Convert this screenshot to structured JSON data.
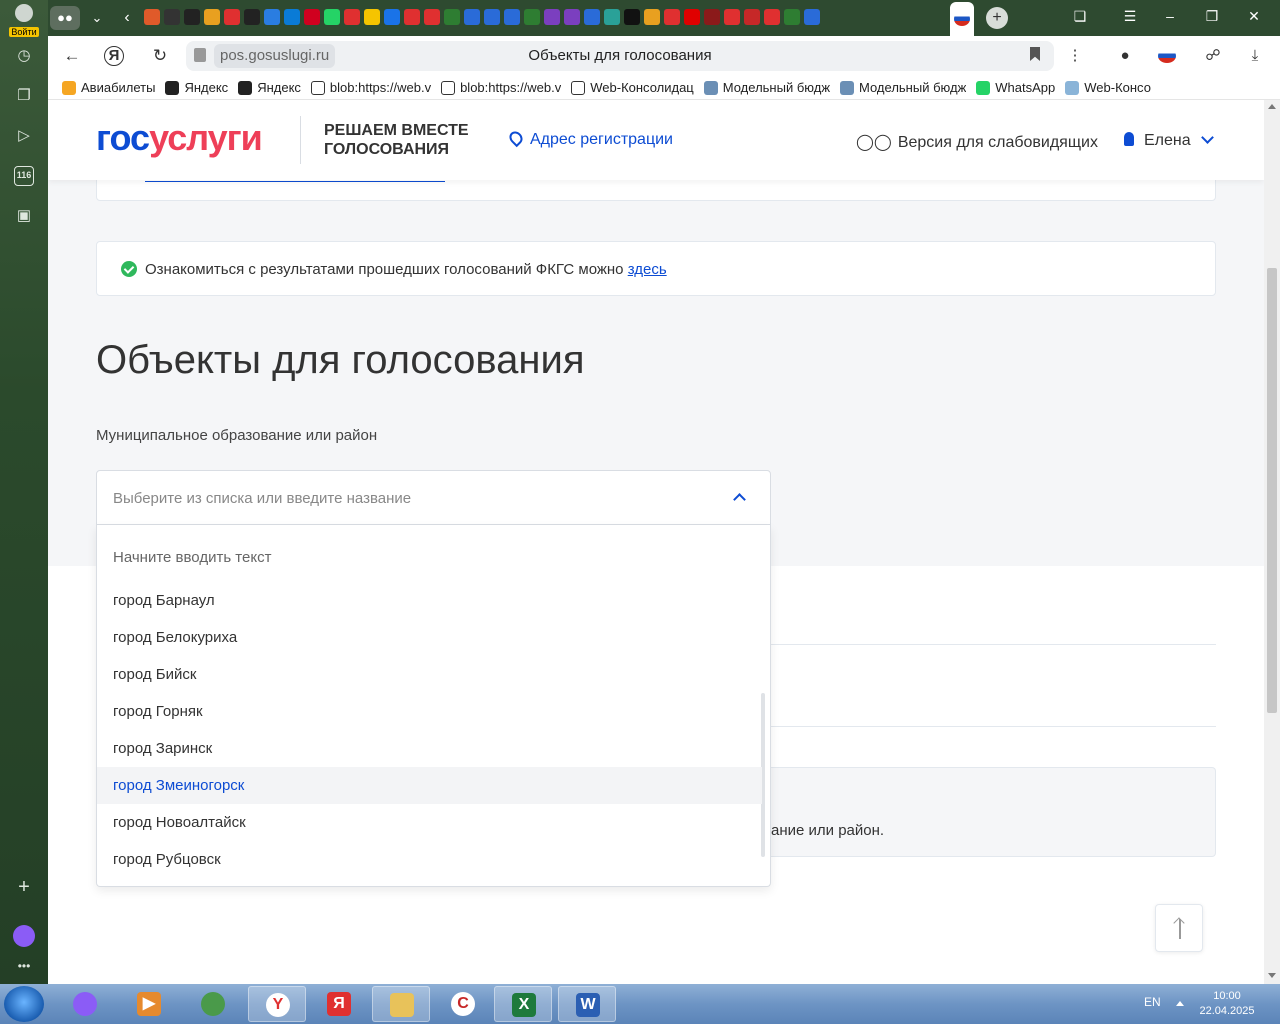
{
  "browser": {
    "login_label": "Войти",
    "omnibox_domain": "pos.gosuslugi.ru",
    "page_title": "Объекты для голосования",
    "tab_favicon_colors": [
      "#e05a2a",
      "#333333",
      "#222222",
      "#e8a020",
      "#e03030",
      "#222222",
      "#2a7de1",
      "#0a7bd6",
      "#d0001f",
      "#25d366",
      "#e03030",
      "#f5c400",
      "#1a73e8",
      "#e03030",
      "#e03030",
      "#2e7d32",
      "#2a6bd8",
      "#2a6bd8",
      "#2a6bd8",
      "#2e7d32",
      "#7b3fbf",
      "#7b3fbf",
      "#2a6bd8",
      "#2aa198",
      "#111111",
      "#e8a020",
      "#e03030",
      "#e00000",
      "#8b1a1a",
      "#e03030",
      "#c62828",
      "#e03030",
      "#2e7d32",
      "#2a6bd8"
    ],
    "sidebar_badge": "116",
    "bookmarks": [
      {
        "label": "Авиабилеты",
        "icon": "plane-icon",
        "color": "#f5a623"
      },
      {
        "label": "Яндекс",
        "icon": "yandex-plus-icon",
        "color": "#222222"
      },
      {
        "label": "Яндекс",
        "icon": "yandex-plus-icon",
        "color": "#222222"
      },
      {
        "label": "blob:https://web.v",
        "icon": "document-icon",
        "color": "#ffffff"
      },
      {
        "label": "blob:https://web.v",
        "icon": "document-icon",
        "color": "#ffffff"
      },
      {
        "label": "Web-Консолидац",
        "icon": "document-icon",
        "color": "#ffffff"
      },
      {
        "label": "Модельный бюдж",
        "icon": "budget-icon",
        "color": "#6b8fb5"
      },
      {
        "label": "Модельный бюдж",
        "icon": "budget-icon",
        "color": "#6b8fb5"
      },
      {
        "label": "WhatsApp",
        "icon": "whatsapp-icon",
        "color": "#25d366"
      },
      {
        "label": "Web-Консо",
        "icon": "web-icon",
        "color": "#8ab4d8"
      }
    ]
  },
  "site": {
    "logo_part1": "гос",
    "logo_part2": "услуги",
    "slogan": "РЕШАЕМ ВМЕСТЕ ГОЛОСОВАНИЯ",
    "address_link": "Адрес регистрации",
    "vision_link": "Версия для слабовидящих",
    "user_name": "Елена",
    "brand_blue": "#0d4cd3",
    "brand_red": "#ee3f58"
  },
  "info": {
    "text": "Ознакомиться с результатами прошедших голосований ФКГС можно ",
    "link": "здесь"
  },
  "main": {
    "heading": "Объекты для голосования",
    "field_label": "Муниципальное образование или район",
    "field_placeholder": "Выберите из списка или введите название",
    "dropdown_hint": "Начните вводить текст",
    "options": [
      "город Барнаул",
      "город Белокуриха",
      "город Бийск",
      "город Горняк",
      "город Заринск",
      "город Змеиногорск",
      "город Новоалтайск",
      "город Рубцовск"
    ],
    "highlighted_option": "город Змеиногорск",
    "hidden_notice_tail": "ание или район."
  },
  "taskbar": {
    "lang": "EN",
    "time": "10:00",
    "date": "22.04.2025",
    "apps": [
      "alice",
      "media-player",
      "security",
      "yandex-browser",
      "yandex",
      "explorer",
      "c-app",
      "excel",
      "word"
    ]
  }
}
